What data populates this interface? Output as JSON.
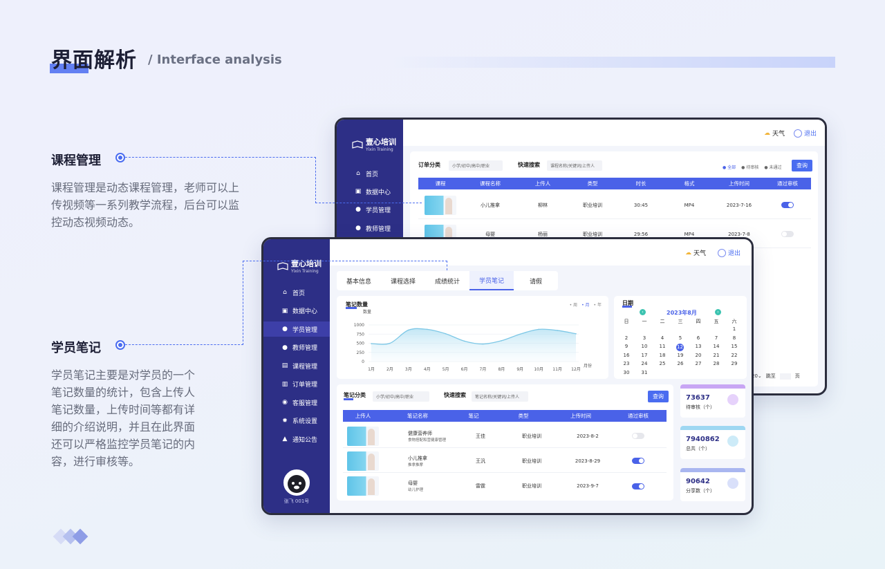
{
  "header": {
    "title": "界面解析",
    "subtitle": "/ Interface analysis"
  },
  "sections": [
    {
      "title": "课程管理",
      "body": [
        "课程管理是动态课程管理，老师可以上",
        "传视频等一系列教学流程，后台可以监",
        "控动态视频动态。"
      ]
    },
    {
      "title": "学员笔记",
      "body": [
        "学员笔记主要是对学员的一个",
        "笔记数量的统计，包含上传人",
        "笔记数量，上传时间等都有详",
        "细的介绍说明，并且在此界面",
        "还可以严格监控学员笔记的内",
        "容，进行审核等。"
      ]
    }
  ],
  "app": {
    "logo": "壹心培训",
    "logo_sub": "Yixin Training",
    "weather": "天气",
    "logout": "退出",
    "nav_back": [
      "首页",
      "数据中心",
      "学员管理",
      "教师管理"
    ],
    "nav_front": [
      "首页",
      "数据中心",
      "学员管理",
      "教师管理",
      "课程管理",
      "订单管理",
      "客服管理",
      "系统设置",
      "通知公告"
    ],
    "nav_icons": [
      "home-icon",
      "chart-icon",
      "user-icon",
      "teacher-icon",
      "book-icon",
      "order-icon",
      "service-icon",
      "gear-icon",
      "bell-icon"
    ],
    "user": "张飞  001号"
  },
  "back_screen": {
    "filter_label": "订单分类",
    "filter_placeholder": "小学/初中/高中/职业",
    "search_label": "快速搜索",
    "search_placeholder": "课程名称/关键词/上传人",
    "radios": [
      "全部",
      "待审核",
      "未通过"
    ],
    "query": "查询",
    "columns": [
      "课程",
      "课程名称",
      "上传人",
      "类型",
      "时长",
      "格式",
      "上传时间",
      "通过审核"
    ],
    "rows": [
      {
        "name": "小儿推拿",
        "uploader": "柳林",
        "type": "职业培训",
        "duration": "30:45",
        "format": "MP4",
        "date": "2023-7-16",
        "on": true
      },
      {
        "name": "母婴",
        "uploader": "杨丽",
        "type": "职业培训",
        "duration": "29:56",
        "format": "MP4",
        "date": "2023-7-8",
        "on": false
      }
    ],
    "extra_toggles": [
      true,
      true,
      true,
      true
    ],
    "pager_suffix": "20",
    "pager_jump": "跳至",
    "pager_page": "页"
  },
  "front_screen": {
    "tabs": [
      "基本信息",
      "课程选择",
      "成绩统计",
      "学员笔记",
      "请假"
    ],
    "active_tab": 3,
    "chart_title": "笔记数量",
    "chart_legend": [
      "周",
      "月",
      "年"
    ],
    "calendar": {
      "title": "日期",
      "month": "2023年8月",
      "weekdays": [
        "日",
        "一",
        "二",
        "三",
        "四",
        "五",
        "六"
      ],
      "days": [
        "",
        "",
        "",
        "",
        "",
        "",
        "1",
        "2",
        "3",
        "4",
        "5",
        "6",
        "7",
        "8",
        "9",
        "10",
        "11",
        "12",
        "13",
        "14",
        "15",
        "16",
        "17",
        "18",
        "19",
        "20",
        "21",
        "22",
        "23",
        "24",
        "25",
        "26",
        "27",
        "28",
        "29",
        "30",
        "31"
      ],
      "selected": "12"
    },
    "filter_label": "笔记分类",
    "filter_placeholder": "小学/初中/高中/职业",
    "search_label": "快速搜索",
    "search_placeholder": "笔记名称/关键词/上传人",
    "query": "查询",
    "columns": [
      "上传人",
      "笔记名称",
      "笔记",
      "类型",
      "上传时间",
      "通过审核"
    ],
    "rows": [
      {
        "title": "健康营养师",
        "sub": "食物搭配和营健康管理",
        "note": "王佳",
        "type": "职业培训",
        "date": "2023-8-2",
        "on": false
      },
      {
        "title": "小儿推拿",
        "sub": "推拿推摩",
        "note": "王汎",
        "type": "职业培训",
        "date": "2023-8-29",
        "on": true
      },
      {
        "title": "母婴",
        "sub": "幼儿护理",
        "note": "雷霆",
        "type": "职业培训",
        "date": "2023-9-7",
        "on": true
      }
    ],
    "stats": [
      {
        "value": "73637",
        "label": "待审核（个）",
        "color": "#c8a6f4",
        "icon": "pending-icon"
      },
      {
        "value": "7940862",
        "label": "总共（个）",
        "color": "#9ed7f2",
        "icon": "total-icon"
      },
      {
        "value": "90642",
        "label": "分享数（个）",
        "color": "#a9b6f0",
        "icon": "share-icon"
      }
    ]
  },
  "chart_data": {
    "type": "area",
    "title": "笔记数量",
    "ylabel": "数量",
    "xlabel": "月份",
    "categories": [
      "1月",
      "2月",
      "3月",
      "4月",
      "5月",
      "6月",
      "7月",
      "8月",
      "9月",
      "10月",
      "11月",
      "12月"
    ],
    "values": [
      490,
      500,
      860,
      880,
      760,
      560,
      480,
      570,
      750,
      880,
      850,
      760
    ],
    "ylim": [
      0,
      1000
    ],
    "yticks": [
      "1000",
      "750",
      "500",
      "250",
      "0"
    ],
    "legend": [
      "周",
      "月",
      "年"
    ],
    "active_legend": "月",
    "color": "#7cc7e6"
  }
}
